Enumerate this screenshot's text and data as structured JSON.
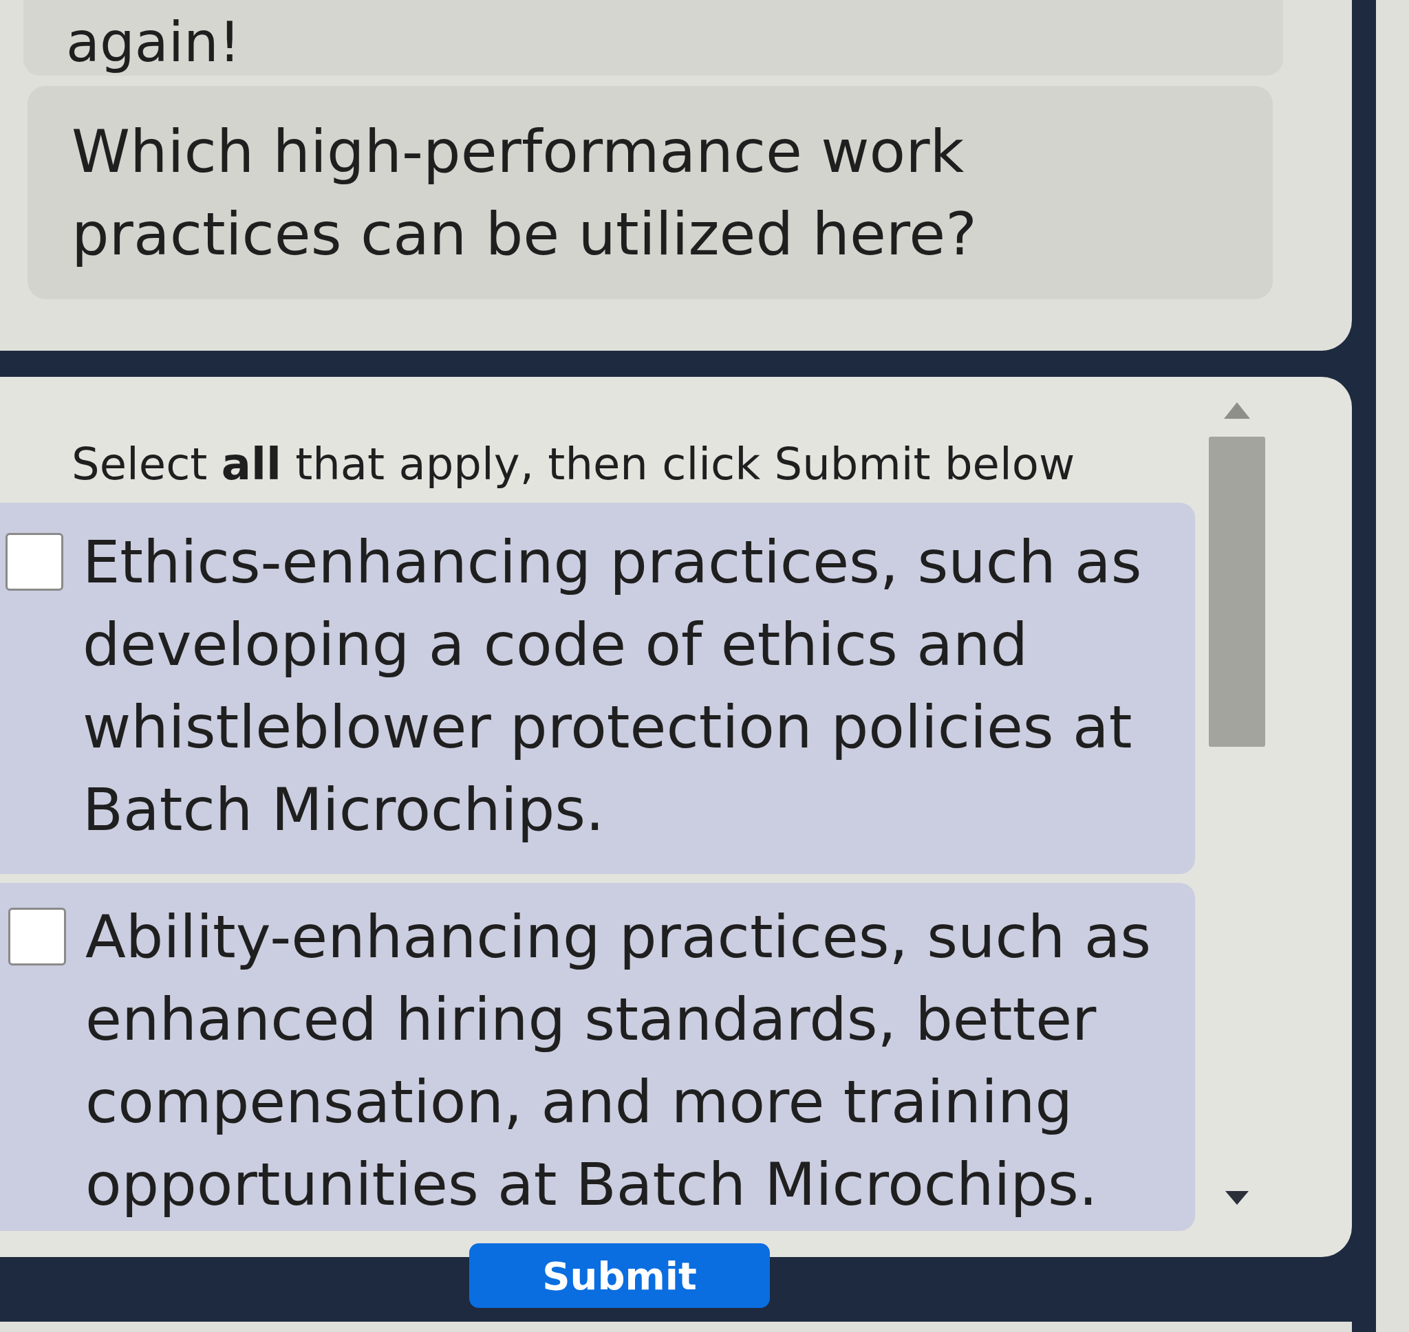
{
  "previous_message": {
    "text": "again!"
  },
  "question": {
    "text": "Which high-performance work practices can be utilized here?"
  },
  "instructions": "Select **all** that apply, then click Submit below",
  "options": [
    {
      "text": "Ethics-enhancing practices, such as developing a code of ethics and whistleblower protection policies at Batch Microchips.",
      "checked": false
    },
    {
      "text": "Ability-enhancing practices, such as enhanced hiring standards, better compensation, and more training opportunities at Batch Microchips.",
      "checked": false
    }
  ],
  "submit_button": {
    "label": "Submit"
  }
}
